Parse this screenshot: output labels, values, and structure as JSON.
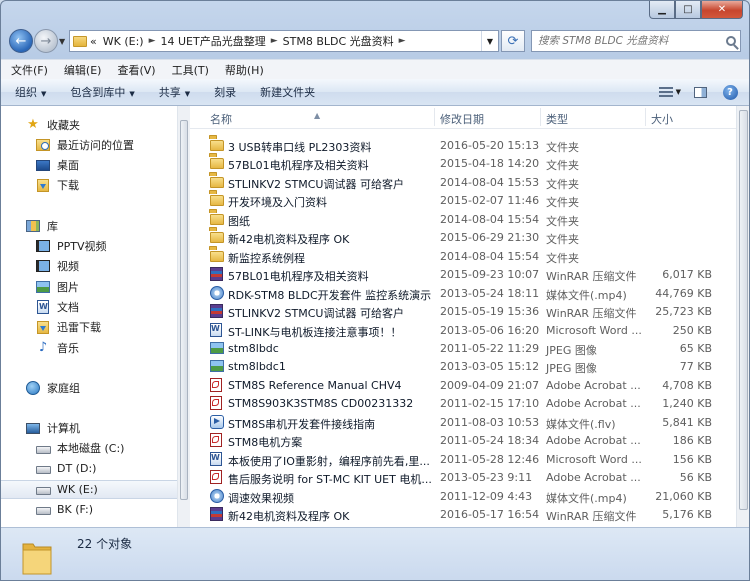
{
  "address": {
    "prefix": "«",
    "crumbs": [
      "WK (E:)",
      "14 UET产品光盘整理",
      "STM8 BLDC 光盘资料"
    ]
  },
  "search": {
    "placeholder": "搜索 STM8 BLDC 光盘资料"
  },
  "menu": [
    "文件(F)",
    "编辑(E)",
    "查看(V)",
    "工具(T)",
    "帮助(H)"
  ],
  "commands": [
    {
      "label": "组织",
      "dropdown": true
    },
    {
      "label": "包含到库中",
      "dropdown": true
    },
    {
      "label": "共享",
      "dropdown": true
    },
    {
      "label": "刻录",
      "dropdown": false
    },
    {
      "label": "新建文件夹",
      "dropdown": false
    }
  ],
  "nav": [
    {
      "label": "收藏夹",
      "icon": "star-icon",
      "indent": 0,
      "gap": 0
    },
    {
      "label": "最近访问的位置",
      "icon": "recent-places-icon",
      "indent": 1,
      "gap": 0
    },
    {
      "label": "桌面",
      "icon": "desktop-icon",
      "indent": 1,
      "gap": 0
    },
    {
      "label": "下载",
      "icon": "downloads-icon",
      "indent": 1,
      "gap": 0
    },
    {
      "label": "库",
      "icon": "library-icon",
      "indent": 0,
      "gap": 1
    },
    {
      "label": "PPTV视频",
      "icon": "video-library-icon",
      "indent": 1,
      "gap": 0
    },
    {
      "label": "视频",
      "icon": "video-library-icon",
      "indent": 1,
      "gap": 0
    },
    {
      "label": "图片",
      "icon": "pictures-icon",
      "indent": 1,
      "gap": 0
    },
    {
      "label": "文档",
      "icon": "documents-icon",
      "indent": 1,
      "gap": 0
    },
    {
      "label": "迅雷下载",
      "icon": "downloads-icon",
      "indent": 1,
      "gap": 0
    },
    {
      "label": "音乐",
      "icon": "music-icon",
      "indent": 1,
      "gap": 0
    },
    {
      "label": "家庭组",
      "icon": "homegroup-icon",
      "indent": 0,
      "gap": 1
    },
    {
      "label": "计算机",
      "icon": "computer-icon",
      "indent": 0,
      "gap": 1
    },
    {
      "label": "本地磁盘 (C:)",
      "icon": "drive-icon",
      "indent": 1,
      "gap": 0
    },
    {
      "label": "DT (D:)",
      "icon": "drive-icon",
      "indent": 1,
      "gap": 0
    },
    {
      "label": "WK (E:)",
      "icon": "drive-icon",
      "indent": 1,
      "gap": 0,
      "selected": true
    },
    {
      "label": "BK (F:)",
      "icon": "drive-icon",
      "indent": 1,
      "gap": 0
    }
  ],
  "columns": {
    "name": "名称",
    "date": "修改日期",
    "type": "类型",
    "size": "大小"
  },
  "files": [
    {
      "name": "3 USB转串口线 PL2303资料",
      "date": "2016-05-20 15:13",
      "type": "文件夹",
      "size": "",
      "icon": "folder"
    },
    {
      "name": "57BL01电机程序及相关资料",
      "date": "2015-04-18 14:20",
      "type": "文件夹",
      "size": "",
      "icon": "folder"
    },
    {
      "name": "STLINKV2 STMCU调试器 可给客户",
      "date": "2014-08-04 15:53",
      "type": "文件夹",
      "size": "",
      "icon": "folder"
    },
    {
      "name": "开发环境及入门资料",
      "date": "2015-02-07 11:46",
      "type": "文件夹",
      "size": "",
      "icon": "folder"
    },
    {
      "name": "图纸",
      "date": "2014-08-04 15:54",
      "type": "文件夹",
      "size": "",
      "icon": "folder"
    },
    {
      "name": "新42电机资料及程序 OK",
      "date": "2015-06-29 21:30",
      "type": "文件夹",
      "size": "",
      "icon": "folder"
    },
    {
      "name": "新监控系统例程",
      "date": "2014-08-04 15:54",
      "type": "文件夹",
      "size": "",
      "icon": "folder"
    },
    {
      "name": "57BL01电机程序及相关资料",
      "date": "2015-09-23 10:07",
      "type": "WinRAR 压缩文件",
      "size": "6,017 KB",
      "icon": "rar"
    },
    {
      "name": "RDK-STM8 BLDC开发套件 监控系统演示",
      "date": "2013-05-24 18:11",
      "type": "媒体文件(.mp4)",
      "size": "44,769 KB",
      "icon": "mp4"
    },
    {
      "name": "STLINKV2 STMCU调试器 可给客户",
      "date": "2015-05-19 15:36",
      "type": "WinRAR 压缩文件",
      "size": "25,723 KB",
      "icon": "rar"
    },
    {
      "name": "ST-LINK与电机板连接注意事项！！",
      "date": "2013-05-06 16:20",
      "type": "Microsoft Word ...",
      "size": "250 KB",
      "icon": "doc"
    },
    {
      "name": "stm8lbdc",
      "date": "2011-05-22 11:29",
      "type": "JPEG 图像",
      "size": "65 KB",
      "icon": "jpg"
    },
    {
      "name": "stm8lbdc1",
      "date": "2013-03-05 15:12",
      "type": "JPEG 图像",
      "size": "77 KB",
      "icon": "jpg"
    },
    {
      "name": "STM8S Reference Manual CHV4",
      "date": "2009-04-09 21:07",
      "type": "Adobe Acrobat ...",
      "size": "4,708 KB",
      "icon": "pdf"
    },
    {
      "name": "STM8S903K3STM8S CD00231332",
      "date": "2011-02-15 17:10",
      "type": "Adobe Acrobat ...",
      "size": "1,240 KB",
      "icon": "pdf"
    },
    {
      "name": "STM8S串机开发套件接线指南",
      "date": "2011-08-03 10:53",
      "type": "媒体文件(.flv)",
      "size": "5,841 KB",
      "icon": "flv"
    },
    {
      "name": "STM8电机方案",
      "date": "2011-05-24 18:34",
      "type": "Adobe Acrobat ...",
      "size": "186 KB",
      "icon": "pdf"
    },
    {
      "name": "本板使用了IO重影射，编程序前先看,里...",
      "date": "2011-05-28 12:46",
      "type": "Microsoft Word ...",
      "size": "156 KB",
      "icon": "doc"
    },
    {
      "name": "售后服务说明 for ST-MC KIT UET 电机...",
      "date": "2013-05-23 9:11",
      "type": "Adobe Acrobat ...",
      "size": "56 KB",
      "icon": "pdf"
    },
    {
      "name": "调速效果视频",
      "date": "2011-12-09 4:43",
      "type": "媒体文件(.mp4)",
      "size": "21,060 KB",
      "icon": "mp4"
    },
    {
      "name": "新42电机资料及程序 OK",
      "date": "2016-05-17 16:54",
      "type": "WinRAR 压缩文件",
      "size": "5,176 KB",
      "icon": "rar"
    }
  ],
  "status": {
    "count": "22 个对象"
  }
}
